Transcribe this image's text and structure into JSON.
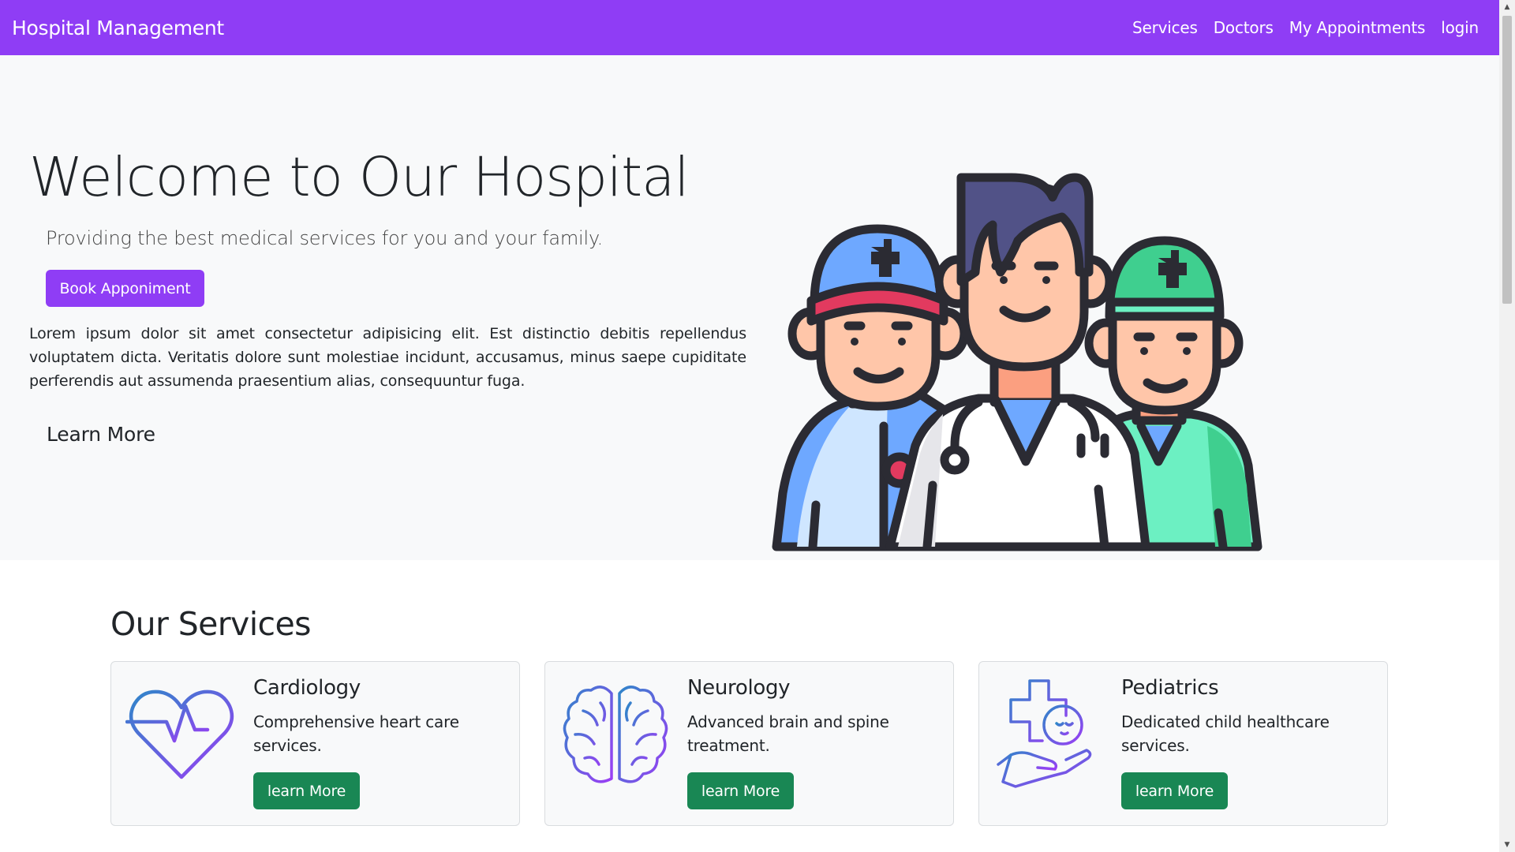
{
  "navbar": {
    "brand": "Hospital Management",
    "links": [
      "Services",
      "Doctors",
      "My Appointments",
      "login"
    ],
    "color": "#8f3df5"
  },
  "hero": {
    "title": "Welcome to Our Hospital",
    "subtitle": "Providing the best medical services for you and your family.",
    "book_button": "Book Apponiment",
    "paragraph": "Lorem ipsum dolor sit amet consectetur adipisicing elit. Est distinctio debitis repellendus voluptatem dicta. Veritatis dolore sunt molestiae incidunt, accusamus, minus saepe cupiditate perferendis aut assumenda praesentium alias, consequuntur fuga.",
    "learn_more": "Learn More",
    "illustration": "doctors-team-illustration"
  },
  "services": {
    "heading": "Our Services",
    "cards": [
      {
        "title": "Cardiology",
        "text": "Comprehensive heart care services.",
        "button": "learn More",
        "icon": "heart-pulse-icon"
      },
      {
        "title": "Neurology",
        "text": "Advanced brain and spine treatment.",
        "button": "learn More",
        "icon": "brain-icon"
      },
      {
        "title": "Pediatrics",
        "text": "Dedicated child healthcare services.",
        "button": "learn More",
        "icon": "baby-care-icon"
      }
    ],
    "button_color": "#198754"
  }
}
